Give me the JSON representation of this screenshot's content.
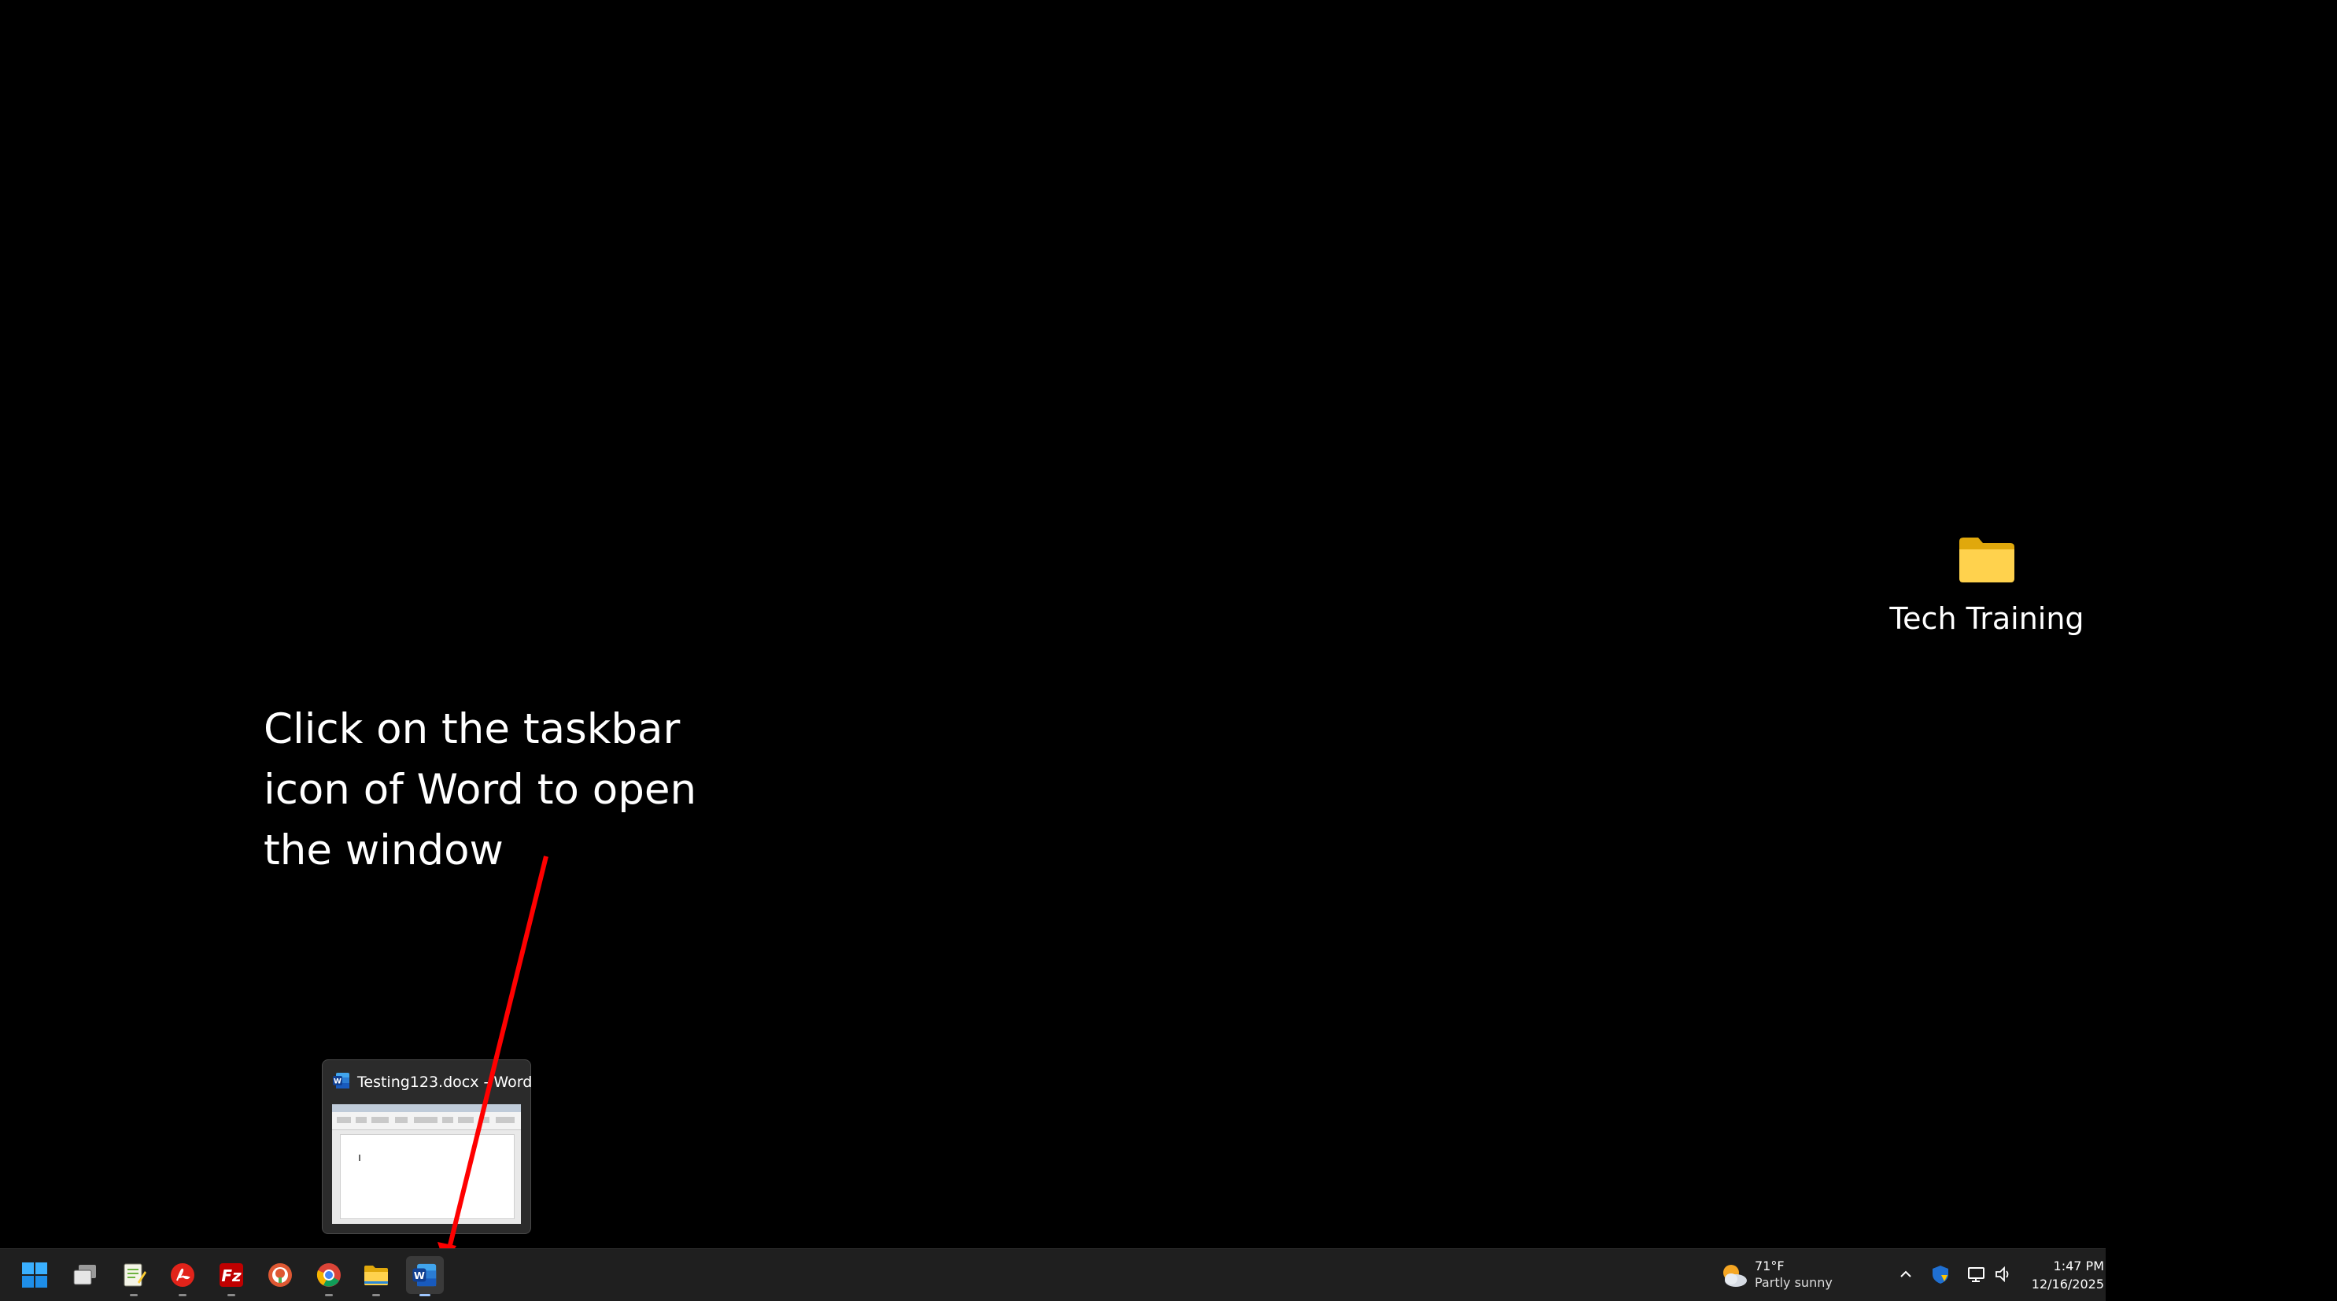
{
  "desktop": {
    "icons": [
      {
        "label": "Tech Training",
        "icon": "folder-icon"
      }
    ]
  },
  "instruction": {
    "lines": [
      "Click on the taskbar",
      "icon of Word to open",
      "the window"
    ],
    "arrow_color": "#ff0000"
  },
  "thumbnail": {
    "title": "Testing123.docx - Word",
    "icon": "word-icon"
  },
  "taskbar": {
    "apps": [
      {
        "name": "start",
        "icon": "windows-start-icon"
      },
      {
        "name": "task-view",
        "icon": "task-view-icon"
      },
      {
        "name": "notepad-plus",
        "icon": "notepad-icon"
      },
      {
        "name": "acrobat",
        "icon": "pdf-reader-icon"
      },
      {
        "name": "filezilla",
        "icon": "filezilla-icon"
      },
      {
        "name": "duckduckgo",
        "icon": "duckduckgo-icon"
      },
      {
        "name": "chrome",
        "icon": "chrome-icon"
      },
      {
        "name": "file-explorer",
        "icon": "folder-icon"
      },
      {
        "name": "word",
        "icon": "word-icon",
        "active": true
      }
    ],
    "weather": {
      "temp": "71°F",
      "condition": "Partly sunny",
      "icon": "partly-sunny-icon"
    },
    "tray": [
      "chevron-up-icon",
      "security-shield-icon",
      "network-icon",
      "volume-icon"
    ],
    "clock": {
      "time": "1:47 PM",
      "date": "12/16/2025"
    }
  }
}
